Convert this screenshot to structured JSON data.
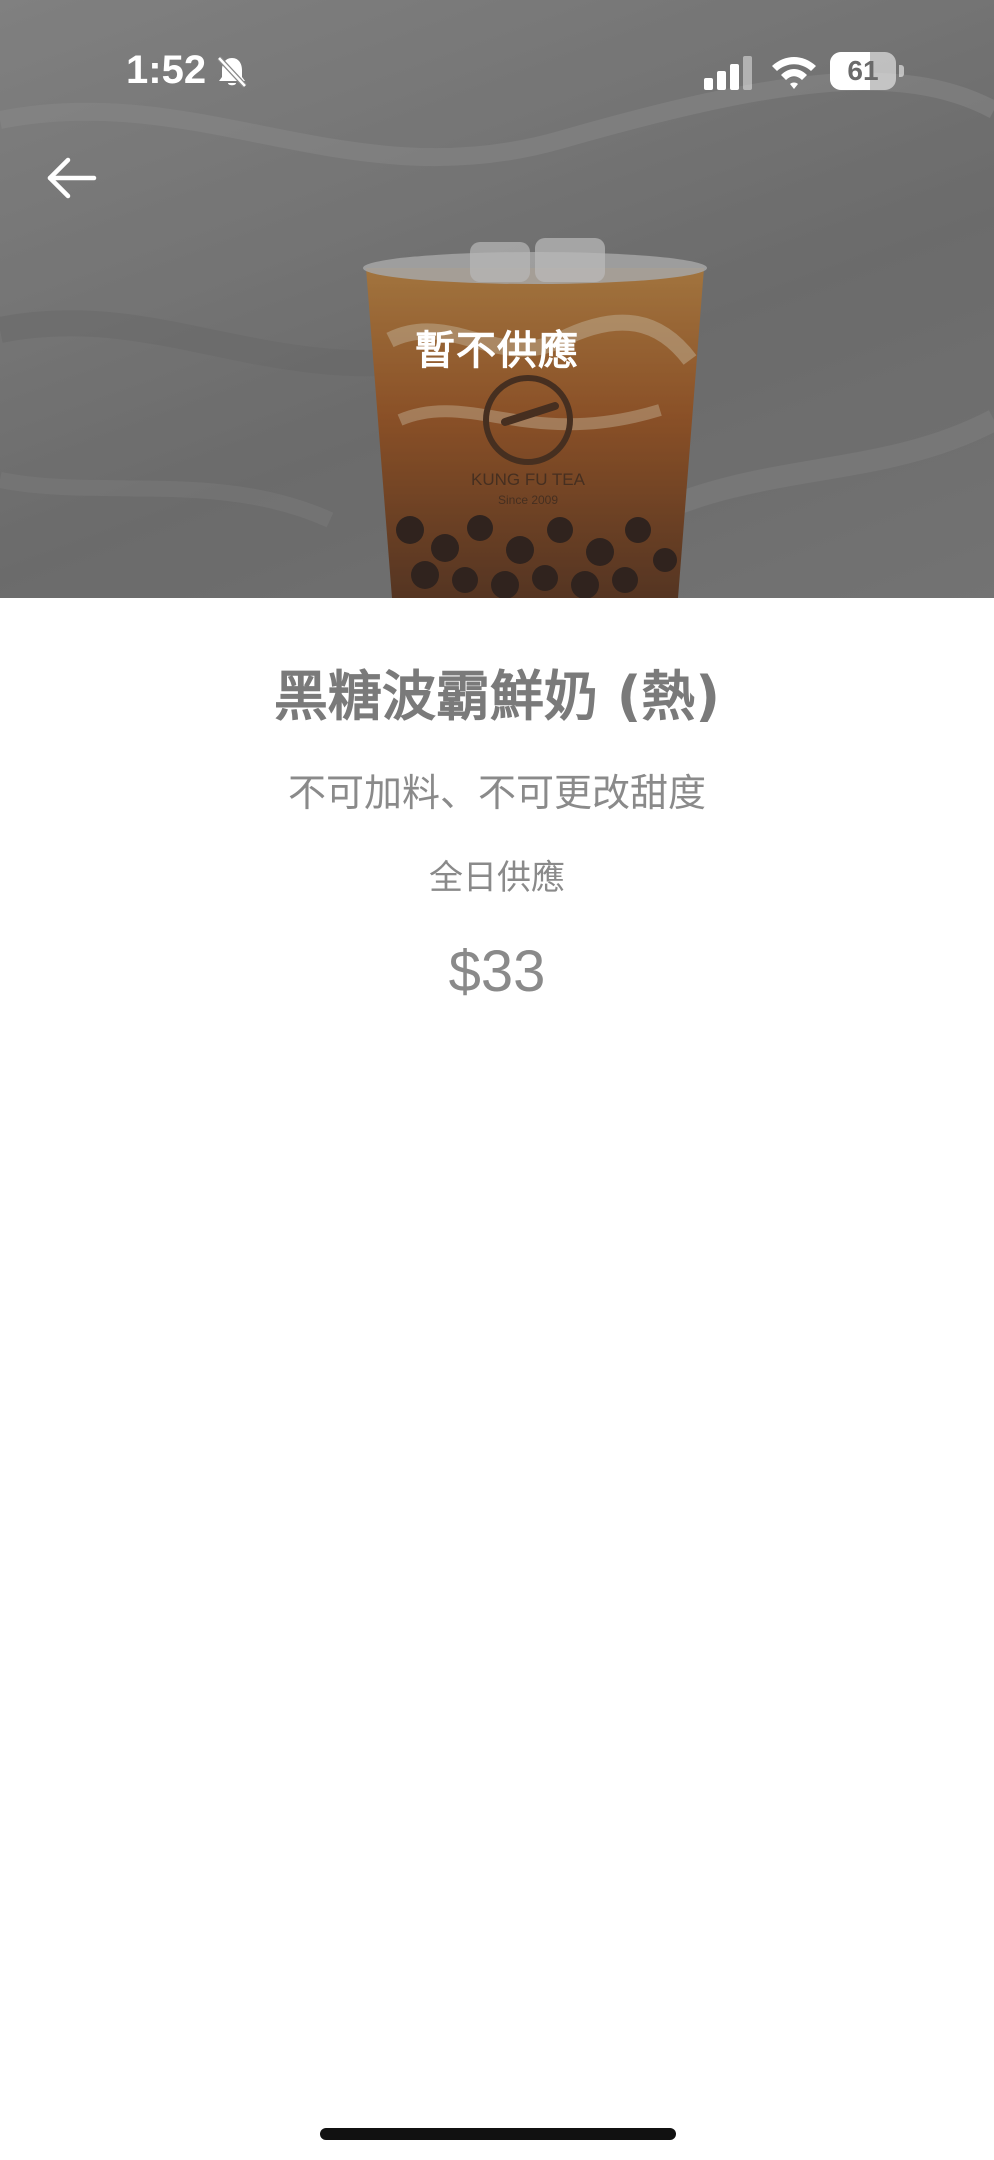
{
  "status_bar": {
    "time": "1:52",
    "battery": "61",
    "battery_level": 0.61,
    "icons": [
      "bell-slash-icon",
      "cellular-signal-icon",
      "wifi-icon",
      "battery-icon"
    ]
  },
  "header": {
    "back_icon": "arrow-left-icon",
    "availability_badge": "暫不供應",
    "image_brand": "KUNG FU TEA",
    "image_since": "Since 2009"
  },
  "product": {
    "name": "黑糖波霸鮮奶 (熱)",
    "note": "不可加料、不可更改甜度",
    "availability": "全日供應",
    "price": "$33"
  },
  "colors": {
    "title_gray": "#7a7a7a",
    "text_gray": "#8a8a8a",
    "overlay_text": "#ffffff"
  }
}
